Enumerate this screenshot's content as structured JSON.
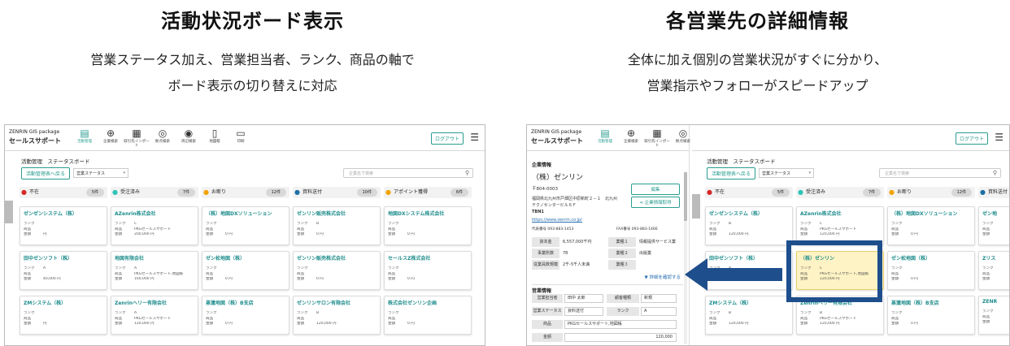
{
  "left": {
    "title": "活動状況ボード表示",
    "desc_line1": "営業ステータス加え、営業担当者、ランク、商品の軸で",
    "desc_line2": "ボード表示の切り替えに対応"
  },
  "right": {
    "title": "各営業先の詳細情報",
    "desc_line1": "全体に加え個別の営業状況がすぐに分かり、",
    "desc_line2": "営業指示やフォローがスピードアップ"
  },
  "app": {
    "brand_small": "ZENRIN GIS package",
    "brand_name": "セールスサポート",
    "nav": [
      {
        "label": "活動管理",
        "icon": "document-icon",
        "glyph": "▤"
      },
      {
        "label": "企業検索",
        "icon": "crosshair-icon",
        "glyph": "⊕"
      },
      {
        "label": "取引先インポート",
        "icon": "file-icon",
        "glyph": "▦"
      },
      {
        "label": "拠点検索",
        "icon": "pin-search-icon",
        "glyph": "◎"
      },
      {
        "label": "周辺検索",
        "icon": "radar-search-icon",
        "glyph": "◉"
      },
      {
        "label": "地図帳",
        "icon": "book-icon",
        "glyph": "▯"
      },
      {
        "label": "印刷",
        "icon": "printer-icon",
        "glyph": "▭"
      }
    ],
    "logout": "ログアウト",
    "menu_glyph": "☰",
    "crumb": "活動管理　ステータスボード",
    "back_btn": "活動管理表へ戻る",
    "select_value": "営業ステータス",
    "search_placeholder": "企業名で検索",
    "search_glyph": "⚲"
  },
  "columns": [
    {
      "name": "不在",
      "count": "5件",
      "color": "#d62828"
    },
    {
      "name": "受注済み",
      "count": "7件",
      "color": "#2ec4b6"
    },
    {
      "name": "お断り",
      "count": "12件",
      "color": "#f4a300"
    },
    {
      "name": "資料送付",
      "count": "10件",
      "color": "#1d6fa5"
    },
    {
      "name": "アポイント獲得",
      "count": "6件",
      "color": "#f4a300"
    }
  ],
  "cards_left": [
    [
      {
        "name": "ゼンゼンシステム（株）",
        "rank": "",
        "product": "",
        "amount": "円"
      },
      {
        "name": "田中ゼンソフト（株）",
        "rank": "A",
        "product": "",
        "amount": "40,000 円"
      },
      {
        "name": "ZMシステム（株）",
        "rank": "",
        "product": "",
        "amount": "円"
      }
    ],
    [
      {
        "name": "AZenrin株式会社",
        "rank": "C",
        "product": "PKGセールスサポート",
        "amount": "200,000 円"
      },
      {
        "name": "地図有限会社",
        "rank": "A",
        "product": "PKGセールスサポート,地図帳",
        "amount": "160,000 円"
      },
      {
        "name": "Zenrinヘリー有限会社",
        "rank": "A",
        "product": "PKGセールスサポート",
        "amount": "120,000 円"
      }
    ],
    [
      {
        "name": "（株）地図DXソリューション",
        "rank": "",
        "product": "",
        "amount": "0 円"
      },
      {
        "name": "ゼン松地図（株）",
        "rank": "",
        "product": "",
        "amount": "0 円"
      },
      {
        "name": "蒸蓮地図（株）B支店",
        "rank": "",
        "product": "",
        "amount": "0 円"
      }
    ],
    [
      {
        "name": "ゼンリン販売株式会社",
        "rank": "B",
        "product": "",
        "amount": "0 円"
      },
      {
        "name": "ゼンリン販売株式会社",
        "rank": "",
        "product": "",
        "amount": "0 円"
      },
      {
        "name": "ゼンリンサロン有限会社",
        "rank": "B",
        "product": "",
        "amount": "120,000 円"
      }
    ],
    [
      {
        "name": "地図DXシステム株式会社",
        "rank": "",
        "product": "",
        "amount": "0 円"
      },
      {
        "name": "セールスZ株式会社",
        "rank": "",
        "product": "",
        "amount": "0 円"
      },
      {
        "name": "株式会社ゼンリン企画",
        "rank": "",
        "product": "",
        "amount": "0 円"
      }
    ]
  ],
  "cards_right": [
    [
      {
        "name": "ゼンゼンシステム（株）",
        "rank": "B",
        "product": "",
        "amount": "120,000 円"
      },
      {
        "name": "田中ゼンソフト（株）",
        "rank": "A",
        "product": "",
        "amount": "40,000 円"
      },
      {
        "name": "ZMシステム（株）",
        "rank": "B",
        "product": "",
        "amount": "120,000 円"
      }
    ],
    [
      {
        "name": "AZenrin株式会社",
        "rank": "C",
        "product": "PKGセールスサポート",
        "amount": "120,000 円"
      },
      {
        "name": "（株）ゼンリン",
        "rank": "C",
        "product": "PKGセールスサポート,地図帳",
        "amount": "120,000 円",
        "highlight": true
      },
      {
        "name": "Zenrinヘリー有限会社",
        "rank": "B",
        "product": "PKGセールスサポート",
        "amount": "120,000 円"
      }
    ],
    [
      {
        "name": "（株）地図DXソリューション",
        "rank": "",
        "product": "",
        "amount": "0 円"
      },
      {
        "name": "ゼン松地図（株）",
        "rank": "",
        "product": "",
        "amount": "0 円"
      },
      {
        "name": "蒸蓮地図（株）B支店",
        "rank": "",
        "product": "",
        "amount": "0 円"
      }
    ],
    [
      {
        "name": "ゼン地",
        "rank": "",
        "product": "",
        "amount": ""
      },
      {
        "name": "Zリス",
        "rank": "",
        "product": "",
        "amount": ""
      },
      {
        "name": "ZENR",
        "rank": "",
        "product": "",
        "amount": ""
      }
    ]
  ],
  "card_labels": {
    "rank": "ランク",
    "product": "商品",
    "amount": "金額"
  },
  "detail": {
    "section1": "企業情報",
    "company": "（株）ゼンリン",
    "edit_btn": "編集",
    "postal": "〒804-0003",
    "address1": "福岡県北九州市戸畑区中原新町２－１　北九州",
    "address2": "テクノセンタービル６Ｆ",
    "tbn": "TBN1",
    "share_btn": "企業情報取得",
    "url": "https://www.zenrin.co.jp/",
    "tel": "代表番号 093-883-1453",
    "fax": "FAX番号 093-883-1466",
    "kv": [
      {
        "k": "資本金",
        "v": "6,557,000千円"
      },
      {
        "k": "業種１",
        "v": "情報提供サービス業"
      },
      {
        "k": "事業所数",
        "v": "78"
      },
      {
        "k": "業種２",
        "v": "出版業"
      },
      {
        "k": "従業員数規模",
        "v": "2千-5千人未満"
      },
      {
        "k": "業種３",
        "v": ""
      }
    ],
    "more": "▼ 詳細を確認する",
    "section2": "営業情報",
    "staff_label": "営業担当者",
    "staff_value": "田中 太郎",
    "type_label": "顧客種類",
    "type_value": "新規",
    "status_label": "営業ステータス",
    "status_value": "資料送付",
    "rank_label": "ランク",
    "rank_value": "A",
    "product_label": "商品",
    "product_value": "PKGセールスサポート,地図帳",
    "amount_label": "金額",
    "amount_value": "120,000"
  }
}
